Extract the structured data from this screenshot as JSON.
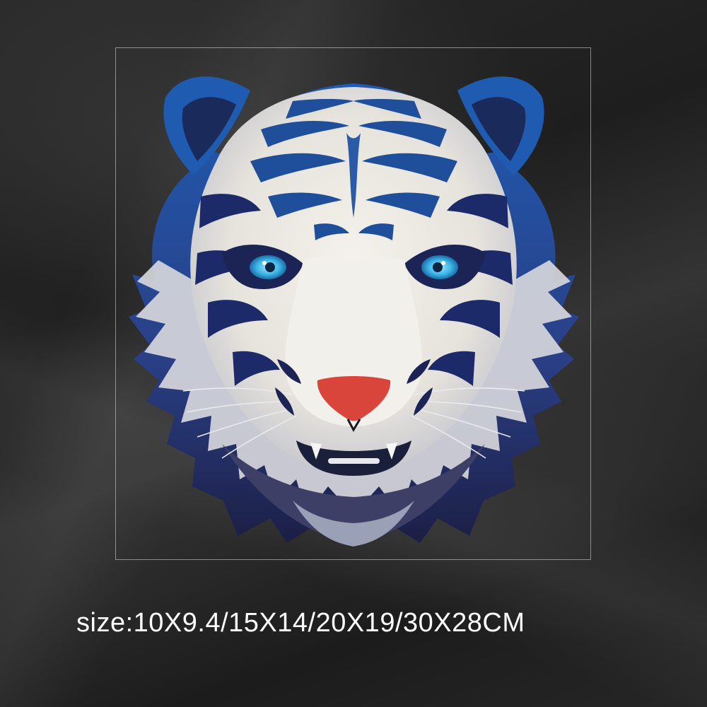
{
  "product": {
    "size_caption": "size:10X9.4/15X14/20X19/30X28CM",
    "artwork": "tiger-head-illustration"
  },
  "colors": {
    "background": "#262626",
    "tiger_blue": "#1f4f9a",
    "tiger_dark": "#1a1f4a",
    "tiger_white": "#f1efe9",
    "eye_blue": "#3fb7e8",
    "nose_red": "#d9453a",
    "caption_text": "#ffffff"
  }
}
